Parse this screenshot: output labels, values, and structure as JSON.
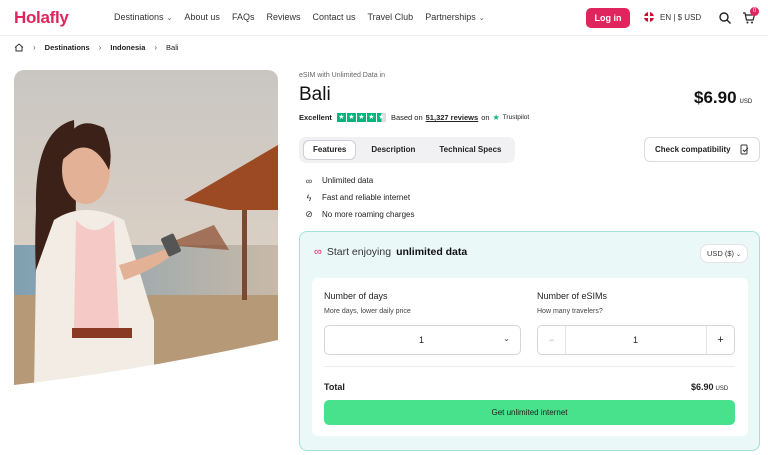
{
  "header": {
    "logo": "Holafly",
    "nav": [
      {
        "label": "Destinations",
        "has_dropdown": true
      },
      {
        "label": "About us",
        "has_dropdown": false
      },
      {
        "label": "FAQs",
        "has_dropdown": false
      },
      {
        "label": "Reviews",
        "has_dropdown": false
      },
      {
        "label": "Contact us",
        "has_dropdown": false
      },
      {
        "label": "Travel Club",
        "has_dropdown": false
      },
      {
        "label": "Partnerships",
        "has_dropdown": true
      }
    ],
    "login_label": "Log in",
    "language": "EN | $ USD",
    "cart_count": "0",
    "brand_color": "#e0245e"
  },
  "breadcrumb": {
    "items": [
      "Destinations",
      "Indonesia",
      "Bali"
    ]
  },
  "product": {
    "subtitle": "eSIM with Unlimited Data in",
    "name": "Bali",
    "price": "$6.90",
    "currency": "USD",
    "rating_word": "Excellent",
    "rating_pre": "Based on",
    "reviews": "51,327 reviews",
    "rating_on": "on",
    "trustpilot": "Trustpilot",
    "stars": 4.5
  },
  "tabs": [
    {
      "label": "Features",
      "active": true
    },
    {
      "label": "Description",
      "active": false
    },
    {
      "label": "Technical Specs",
      "active": false
    }
  ],
  "compatibility_label": "Check compatibility",
  "features": [
    {
      "icon": "infinity-icon",
      "label": "Unlimited data"
    },
    {
      "icon": "lightning-icon",
      "label": "Fast and reliable internet"
    },
    {
      "icon": "no-roaming-icon",
      "label": "No more roaming charges"
    }
  ],
  "plan": {
    "heading_pre": "Start enjoying",
    "heading_bold": "unlimited data",
    "currency_select": "USD ($)",
    "days_label": "Number of days",
    "days_sub": "More days, lower daily price",
    "days_value": "1",
    "esims_label": "Number of eSIMs",
    "esims_sub": "How many travelers?",
    "esims_value": "1",
    "minus": "−",
    "plus": "+",
    "total_label": "Total",
    "total_value": "$6.90",
    "total_currency": "USD",
    "cta": "Get unlimited internet",
    "cta_color": "#48e28c"
  }
}
